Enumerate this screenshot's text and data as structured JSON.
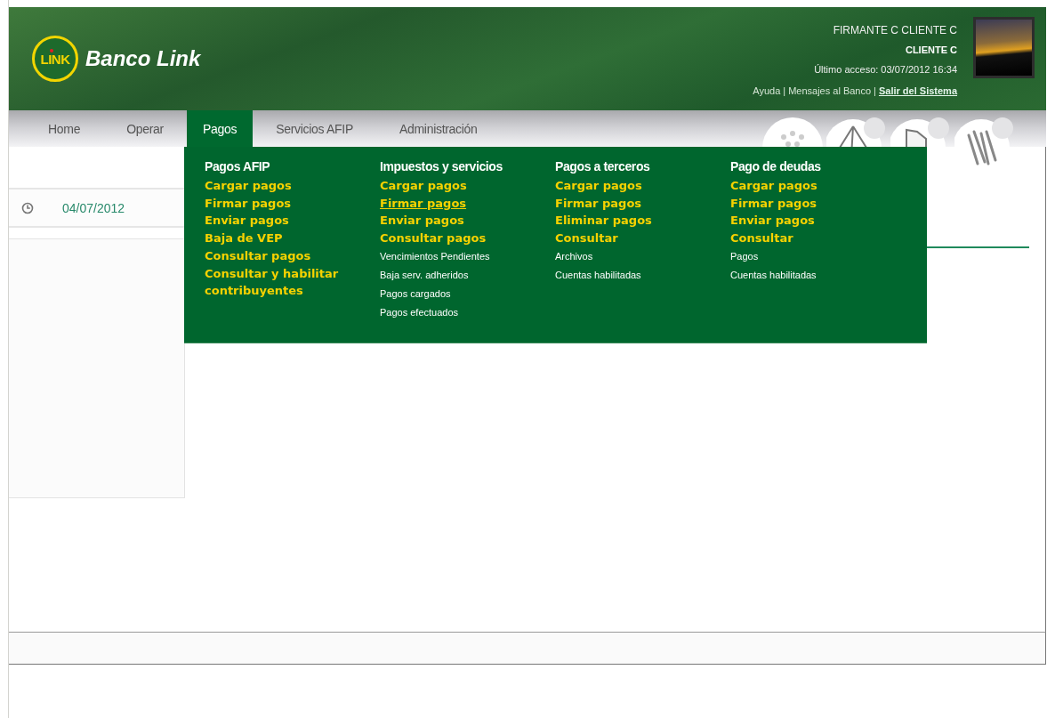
{
  "header": {
    "logo": {
      "badge": "LINK",
      "name": "Banco Link"
    },
    "user": {
      "name": "FIRMANTE C CLIENTE C",
      "client": "CLIENTE C",
      "last_access": "Último acceso: 03/07/2012 16:34"
    },
    "separator": "|",
    "links": [
      {
        "label": "Ayuda",
        "kind": "plain"
      },
      {
        "label": "Mensajes al Banco",
        "kind": "plain"
      },
      {
        "label": "Salir del Sistema",
        "kind": "strong"
      }
    ]
  },
  "tabs": [
    {
      "label": "Home",
      "selected": false
    },
    {
      "label": "Operar",
      "selected": false
    },
    {
      "label": "Pagos",
      "selected": true
    },
    {
      "label": "Servicios AFIP",
      "selected": false
    },
    {
      "label": "Administración",
      "selected": false
    }
  ],
  "menu": {
    "columns": [
      {
        "title": "Pagos AFIP",
        "items": [
          {
            "label": "Cargar pagos",
            "kind": "primary",
            "hovered": false
          },
          {
            "label": "Firmar pagos",
            "kind": "primary",
            "hovered": false
          },
          {
            "label": "Enviar pagos",
            "kind": "primary",
            "hovered": false
          },
          {
            "label": "Baja de VEP",
            "kind": "primary",
            "hovered": false
          },
          {
            "label": "Consultar pagos",
            "kind": "primary",
            "hovered": false
          },
          {
            "label": "Consultar y habilitar contribuyentes",
            "kind": "primary",
            "hovered": false
          }
        ]
      },
      {
        "title": "Impuestos y servicios",
        "items": [
          {
            "label": "Cargar pagos",
            "kind": "primary",
            "hovered": false
          },
          {
            "label": "Firmar pagos",
            "kind": "primary",
            "hovered": true
          },
          {
            "label": "Enviar pagos",
            "kind": "primary",
            "hovered": false
          },
          {
            "label": "Consultar pagos",
            "kind": "primary",
            "hovered": false
          },
          {
            "label": "Vencimientos Pendientes",
            "kind": "secondary",
            "hovered": false
          },
          {
            "label": "Baja serv. adheridos",
            "kind": "secondary",
            "hovered": false
          },
          {
            "label": "Pagos cargados",
            "kind": "secondary",
            "hovered": false
          },
          {
            "label": "Pagos efectuados",
            "kind": "secondary",
            "hovered": false
          }
        ]
      },
      {
        "title": "Pagos a terceros",
        "items": [
          {
            "label": "Cargar pagos",
            "kind": "primary",
            "hovered": false
          },
          {
            "label": "Firmar pagos",
            "kind": "primary",
            "hovered": false
          },
          {
            "label": "Eliminar pagos",
            "kind": "primary",
            "hovered": false
          },
          {
            "label": "Consultar",
            "kind": "primary",
            "hovered": false
          },
          {
            "label": "Archivos",
            "kind": "secondary",
            "hovered": false
          },
          {
            "label": "Cuentas habilitadas",
            "kind": "secondary",
            "hovered": false
          }
        ]
      },
      {
        "title": "Pago de deudas",
        "items": [
          {
            "label": "Cargar pagos",
            "kind": "primary",
            "hovered": false
          },
          {
            "label": "Firmar pagos",
            "kind": "primary",
            "hovered": false
          },
          {
            "label": "Enviar pagos",
            "kind": "primary",
            "hovered": false
          },
          {
            "label": "Consultar",
            "kind": "primary",
            "hovered": false
          },
          {
            "label": "Pagos",
            "kind": "secondary",
            "hovered": false
          },
          {
            "label": "Cuentas habilitadas",
            "kind": "secondary",
            "hovered": false
          }
        ]
      }
    ]
  },
  "sidebar": {
    "date": "04/07/2012"
  }
}
